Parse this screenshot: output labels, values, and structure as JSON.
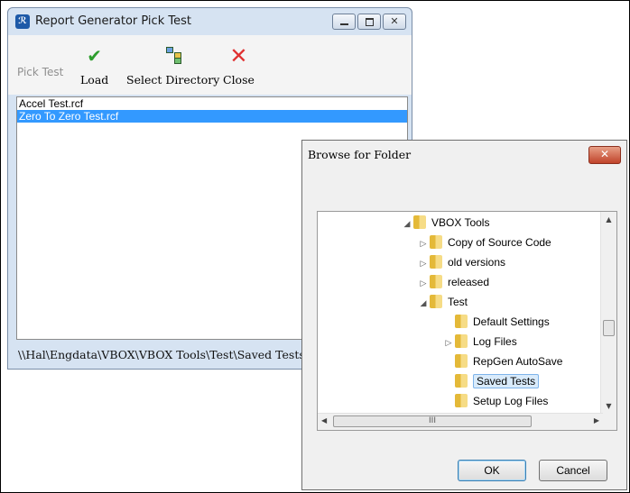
{
  "report_window": {
    "title": "Report Generator Pick Test",
    "app_icon_glyph": "ℛ",
    "toolbar": {
      "pick_test_label": "Pick Test",
      "load_label": "Load",
      "select_directory_label": "Select Directory",
      "close_label": "Close"
    },
    "tests": [
      "Accel Test.rcf",
      "Zero To Zero Test.rcf"
    ],
    "selected_index": 1,
    "status_path": "\\\\Hal\\Engdata\\VBOX\\VBOX Tools\\Test\\Saved Tests"
  },
  "browse_dialog": {
    "title": "Browse for Folder",
    "close_glyph": "✕",
    "tree": [
      {
        "label": "VBOX Tools",
        "expand": "open"
      },
      {
        "label": "Copy of Source Code",
        "expand": "closed"
      },
      {
        "label": "old versions",
        "expand": "closed"
      },
      {
        "label": "released",
        "expand": "closed"
      },
      {
        "label": "Test",
        "expand": "open"
      },
      {
        "label": "Default Settings",
        "expand": "none"
      },
      {
        "label": "Log Files",
        "expand": "closed"
      },
      {
        "label": "RepGen AutoSave",
        "expand": "none"
      },
      {
        "label": "Saved Tests",
        "expand": "none",
        "selected": true
      },
      {
        "label": "Setup Log Files",
        "expand": "none"
      }
    ],
    "hscroll_thumb_glyph": "III",
    "ok_label": "OK",
    "cancel_label": "Cancel"
  },
  "colors": {
    "selection": "#3399ff",
    "window_frame": "#d6e3f2",
    "close_red": "#c0432a",
    "load_green": "#2e9e2e",
    "close_x_red": "#e03030"
  }
}
